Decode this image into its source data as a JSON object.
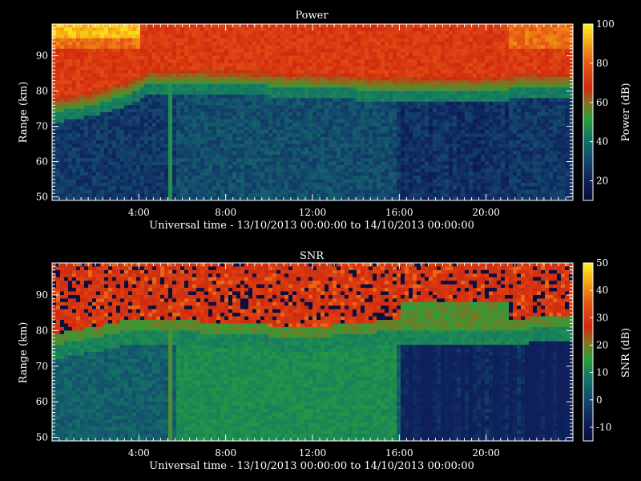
{
  "chart_data": [
    {
      "type": "heatmap",
      "title": "Power",
      "xlabel": "Universal time - 13/10/2013 00:00:00 to 14/10/2013 00:00:00",
      "ylabel": "Range (km)",
      "xlim": [
        0,
        24
      ],
      "ylim": [
        49,
        99
      ],
      "x_ticks": [
        "4:00",
        "8:00",
        "12:00",
        "16:00",
        "20:00"
      ],
      "x_tick_values": [
        4,
        8,
        12,
        16,
        20
      ],
      "y_ticks": [
        "50",
        "60",
        "70",
        "80",
        "90"
      ],
      "y_tick_values": [
        50,
        60,
        70,
        80,
        90
      ],
      "colorbar": {
        "label": "Power (dB)",
        "range": [
          10,
          100
        ],
        "ticks": [
          "20",
          "40",
          "60",
          "80",
          "100"
        ],
        "tick_values": [
          20,
          40,
          60,
          80,
          100
        ]
      },
      "features": {
        "upper_layer_top_km": 99,
        "transition_boundary_km": [
          {
            "t": 0,
            "km": 74
          },
          {
            "t": 2,
            "km": 76
          },
          {
            "t": 3.5,
            "km": 79
          },
          {
            "t": 4.5,
            "km": 82
          },
          {
            "t": 5.5,
            "km": 82
          },
          {
            "t": 8,
            "km": 82
          },
          {
            "t": 12,
            "km": 81
          },
          {
            "t": 16,
            "km": 80
          },
          {
            "t": 20,
            "km": 80
          },
          {
            "t": 22,
            "km": 81
          },
          {
            "t": 24,
            "km": 81
          }
        ],
        "vertical_streak_hour": 5.5
      }
    },
    {
      "type": "heatmap",
      "title": "SNR",
      "xlabel": "Universal time - 13/10/2013 00:00:00 to 14/10/2013 00:00:00",
      "ylabel": "Range (km)",
      "xlim": [
        0,
        24
      ],
      "ylim": [
        49,
        99
      ],
      "x_ticks": [
        "4:00",
        "8:00",
        "12:00",
        "16:00",
        "20:00"
      ],
      "x_tick_values": [
        4,
        8,
        12,
        16,
        20
      ],
      "y_ticks": [
        "50",
        "60",
        "70",
        "80",
        "90"
      ],
      "y_tick_values": [
        50,
        60,
        70,
        80,
        90
      ],
      "colorbar": {
        "label": "SNR (dB)",
        "range": [
          -15,
          50
        ],
        "ticks": [
          "-10",
          "0",
          "10",
          "20",
          "30",
          "40",
          "50"
        ],
        "tick_values": [
          -10,
          0,
          10,
          20,
          30,
          40,
          50
        ]
      },
      "features": {
        "transition_boundary_km": [
          {
            "t": 0,
            "km": 76
          },
          {
            "t": 2,
            "km": 78
          },
          {
            "t": 3.5,
            "km": 80
          },
          {
            "t": 5.5,
            "km": 80
          },
          {
            "t": 8,
            "km": 79
          },
          {
            "t": 12,
            "km": 78
          },
          {
            "t": 16,
            "km": 80
          },
          {
            "t": 20,
            "km": 80
          },
          {
            "t": 24,
            "km": 81
          }
        ],
        "vertical_streak_hour": 5.5
      }
    }
  ]
}
